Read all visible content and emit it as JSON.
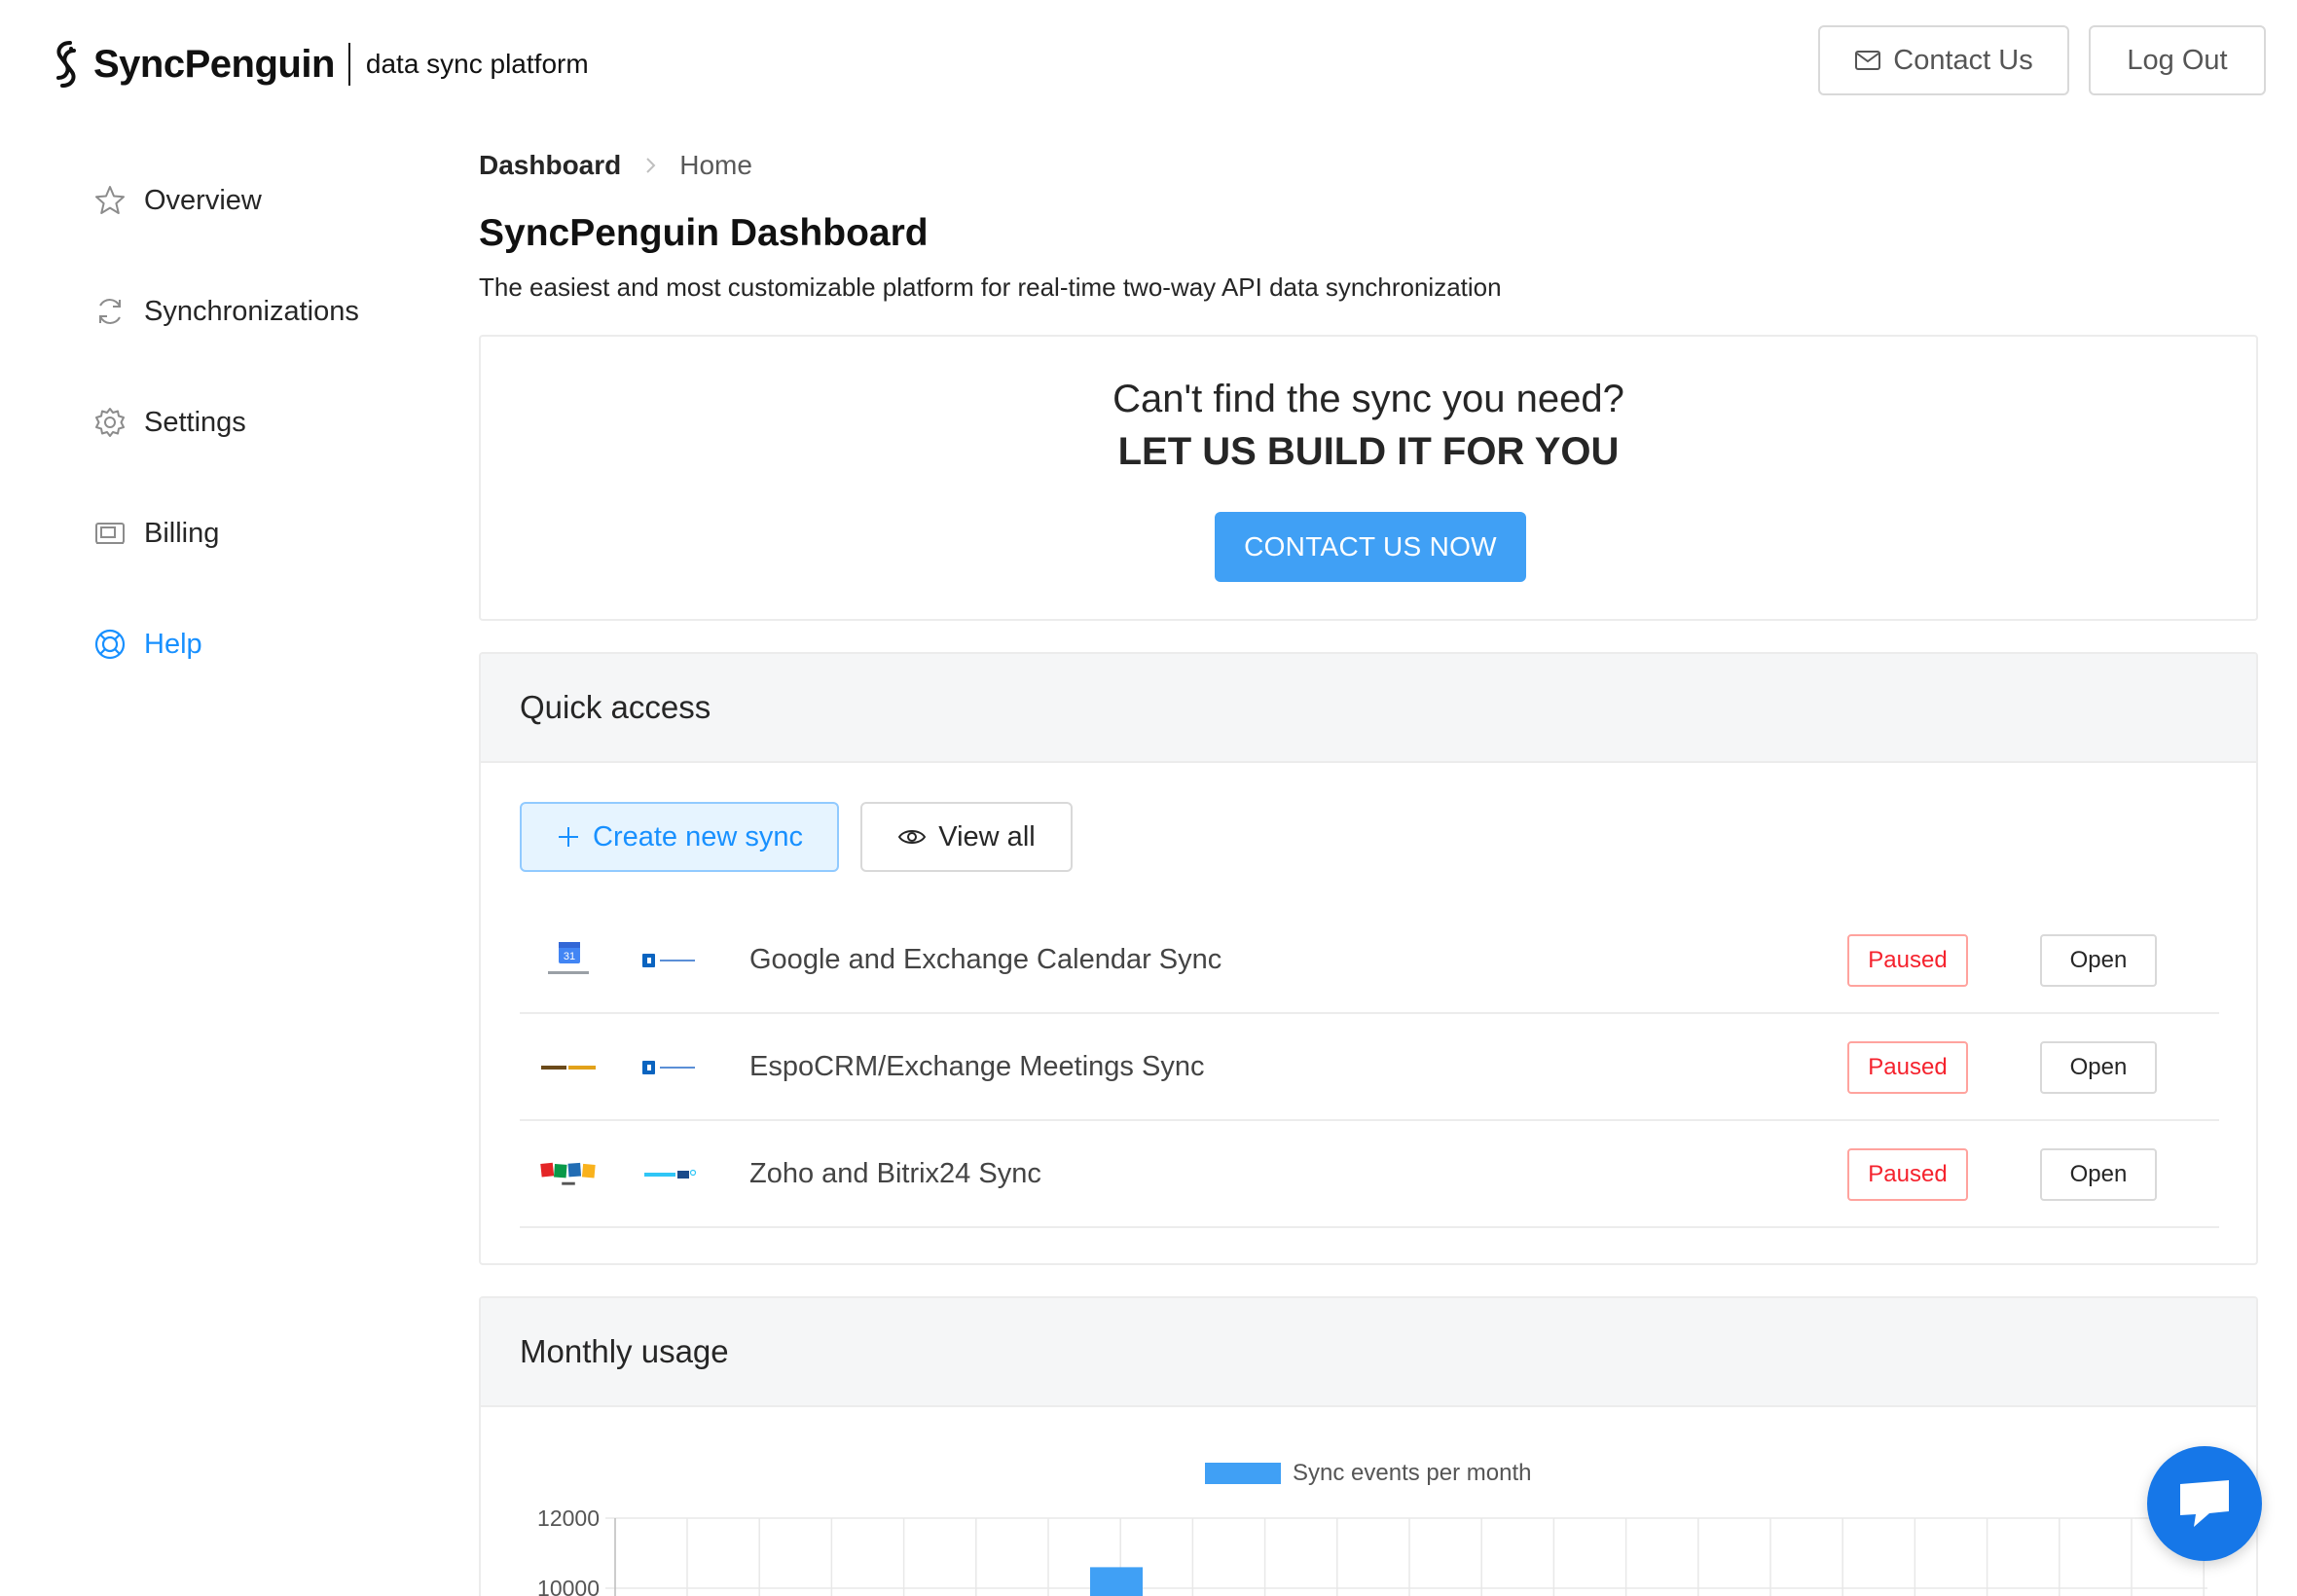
{
  "header": {
    "brand": "SyncPenguin",
    "tagline": "data sync platform",
    "contact_label": "Contact Us",
    "logout_label": "Log Out"
  },
  "sidebar": {
    "items": [
      {
        "label": "Overview",
        "icon": "star-icon",
        "active": false
      },
      {
        "label": "Synchronizations",
        "icon": "sync-icon",
        "active": false
      },
      {
        "label": "Settings",
        "icon": "gear-icon",
        "active": false
      },
      {
        "label": "Billing",
        "icon": "billing-icon",
        "active": false
      },
      {
        "label": "Help",
        "icon": "lifebuoy-icon",
        "active": true
      }
    ]
  },
  "breadcrumb": {
    "root": "Dashboard",
    "current": "Home"
  },
  "page": {
    "title": "SyncPenguin Dashboard",
    "subtitle": "The easiest and most customizable platform for real-time two-way API data synchronization"
  },
  "cta": {
    "question": "Can't find the sync you need?",
    "headline": "LET US BUILD IT FOR YOU",
    "button": "CONTACT US NOW"
  },
  "quick_access": {
    "title": "Quick access",
    "create_label": "Create new sync",
    "view_all_label": "View all",
    "syncs": [
      {
        "name": "Google and Exchange Calendar Sync",
        "status": "Paused",
        "action": "Open",
        "from_app": "Google Calendar",
        "to_app": "Exchange"
      },
      {
        "name": "EspoCRM/Exchange Meetings Sync",
        "status": "Paused",
        "action": "Open",
        "from_app": "EspoCRM",
        "to_app": "Exchange"
      },
      {
        "name": "Zoho and Bitrix24 Sync",
        "status": "Paused",
        "action": "Open",
        "from_app": "Zoho CRM",
        "to_app": "Bitrix24"
      }
    ]
  },
  "monthly_usage": {
    "title": "Monthly usage"
  },
  "chart_data": {
    "type": "bar",
    "series": [
      {
        "name": "Sync events per month",
        "color": "#40a0f5"
      }
    ],
    "yticks_visible": [
      "12000",
      "10000"
    ],
    "visible_bars": [
      {
        "value": 10600
      }
    ],
    "grid": true,
    "legend": "top-center"
  },
  "colors": {
    "accent": "#1890ff",
    "cta": "#40a0f5",
    "paused": "#f5222d",
    "chat": "#1677e8"
  }
}
